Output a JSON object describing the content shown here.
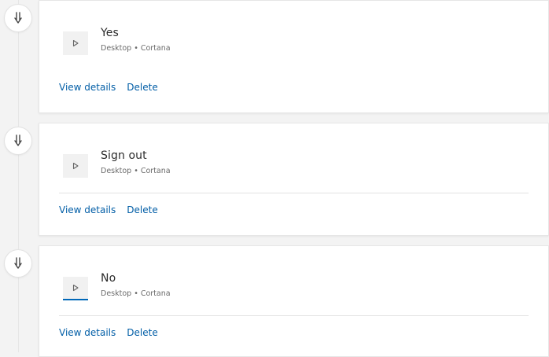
{
  "activities": [
    {
      "title": "Yes",
      "subtitle": "Desktop • Cortana",
      "view_details": "View details",
      "delete": "Delete",
      "has_divider": false,
      "selected": false
    },
    {
      "title": "Sign out",
      "subtitle": "Desktop • Cortana",
      "view_details": "View details",
      "delete": "Delete",
      "has_divider": true,
      "selected": false
    },
    {
      "title": "No",
      "subtitle": "Desktop • Cortana",
      "view_details": "View details",
      "delete": "Delete",
      "has_divider": true,
      "selected": true
    }
  ],
  "icons": {
    "timeline": "voice-input-icon",
    "activity": "play-icon"
  },
  "colors": {
    "link": "#005da6",
    "accent": "#0067b8"
  }
}
